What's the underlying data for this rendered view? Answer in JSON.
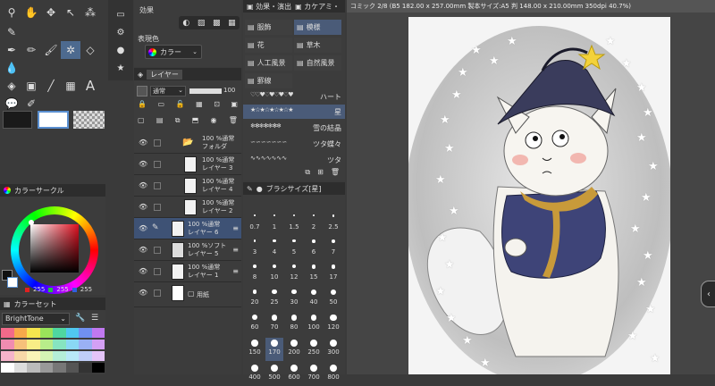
{
  "canvas_tab": {
    "title": "コミック 2/8 (B5 182.00 x 257.00mm 製本サイズ:A5 判 148.00 x 210.00mm 350dpi 40.7%)"
  },
  "sub_tool": {
    "header": "効果",
    "label": "表現色",
    "option": "カラー"
  },
  "material": {
    "tabs": [
      "効果・演出",
      "カケアミ・"
    ],
    "items": [
      {
        "label": "服飾"
      },
      {
        "label": "模様"
      },
      {
        "label": "花"
      },
      {
        "label": "草木"
      },
      {
        "label": "人工風景"
      },
      {
        "label": "自然風景"
      },
      {
        "label": "罫線"
      }
    ],
    "brushes": [
      {
        "label": "ハート"
      },
      {
        "label": "星"
      },
      {
        "label": "雪の結晶"
      },
      {
        "label": "ツタ蝶々"
      },
      {
        "label": "ツタ"
      }
    ]
  },
  "layer": {
    "tab": "レイヤー",
    "blend_mode": "通常",
    "opacity": "100",
    "layers": [
      {
        "line1": "100 %通常",
        "line2": "フォルダ"
      },
      {
        "line1": "100 %通常",
        "line2": "レイヤー 3"
      },
      {
        "line1": "100 %通常",
        "line2": "レイヤー 4"
      },
      {
        "line1": "100 %通常",
        "line2": "レイヤー 2"
      },
      {
        "line1": "100 %通常",
        "line2": "レイヤー 6"
      },
      {
        "line1": "100 %ソフト",
        "line2": "レイヤー 5"
      },
      {
        "line1": "100 %通常",
        "line2": "レイヤー 1"
      },
      {
        "line1": "",
        "line2": "用紙"
      }
    ]
  },
  "brush_size": {
    "title": "ブラシサイズ[星]",
    "sizes": [
      "0.7",
      "1",
      "1.5",
      "2",
      "2.5",
      "3",
      "4",
      "5",
      "6",
      "7",
      "8",
      "10",
      "12",
      "15",
      "17",
      "20",
      "25",
      "30",
      "40",
      "50",
      "60",
      "70",
      "80",
      "100",
      "120",
      "150",
      "170",
      "200",
      "250",
      "300",
      "400",
      "500",
      "600",
      "700",
      "800"
    ]
  },
  "color_circle": {
    "title": "カラーサークル",
    "r": "255",
    "g": "255",
    "b": "255"
  },
  "color_set": {
    "title": "カラーセット",
    "selected": "BrightTone"
  }
}
